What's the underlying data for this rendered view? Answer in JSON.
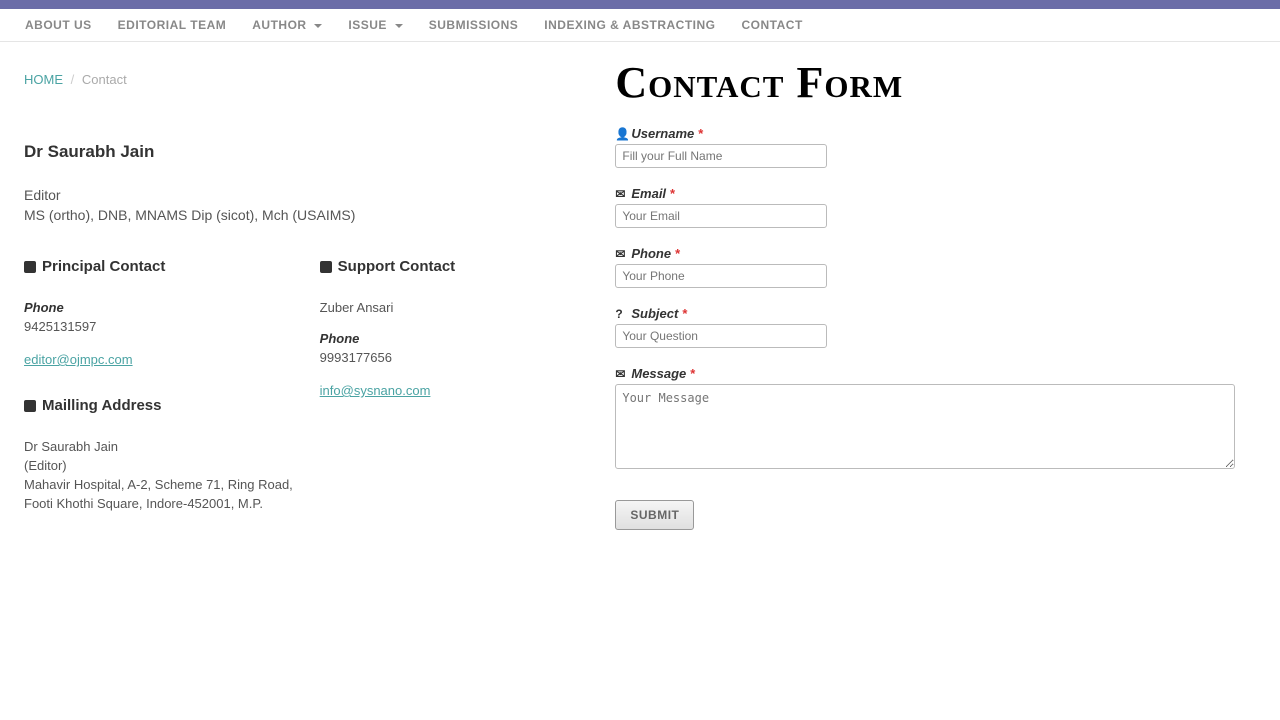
{
  "nav": {
    "about": "ABOUT US",
    "editorial": "EDITORIAL TEAM",
    "author": "AUTHOR",
    "issue": "ISSUE",
    "submissions": "SUBMISSIONS",
    "indexing": "INDEXING & ABSTRACTING",
    "contact": "CONTACT"
  },
  "breadcrumb": {
    "home": "HOME",
    "current": "Contact"
  },
  "contact": {
    "name": "Dr Saurabh Jain",
    "role": "Editor",
    "credentials": "MS (ortho), DNB, MNAMS Dip (sicot), Mch (USAIMS)",
    "principal": {
      "heading": "Principal Contact",
      "phone_label": "Phone",
      "phone": "9425131597",
      "email": "editor@ojmpc.com"
    },
    "support": {
      "heading": "Support Contact",
      "name": "Zuber Ansari",
      "phone_label": "Phone",
      "phone": "9993177656",
      "email": "info@sysnano.com"
    },
    "mailing": {
      "heading": "Mailling Address",
      "line1": "Dr Saurabh Jain",
      "line2": "(Editor)",
      "line3": "Mahavir Hospital, A-2, Scheme 71, Ring Road,",
      "line4": "Footi Khothi Square, Indore-452001, M.P."
    }
  },
  "form": {
    "title": "Contact Form",
    "username": {
      "label": "Username",
      "placeholder": "Fill your Full Name"
    },
    "email": {
      "label": "Email",
      "placeholder": "Your Email"
    },
    "phone": {
      "label": "Phone",
      "placeholder": "Your Phone"
    },
    "subject": {
      "label": "Subject",
      "placeholder": "Your Question"
    },
    "message": {
      "label": "Message",
      "placeholder": "Your Message"
    },
    "submit": "SUBMIT"
  }
}
